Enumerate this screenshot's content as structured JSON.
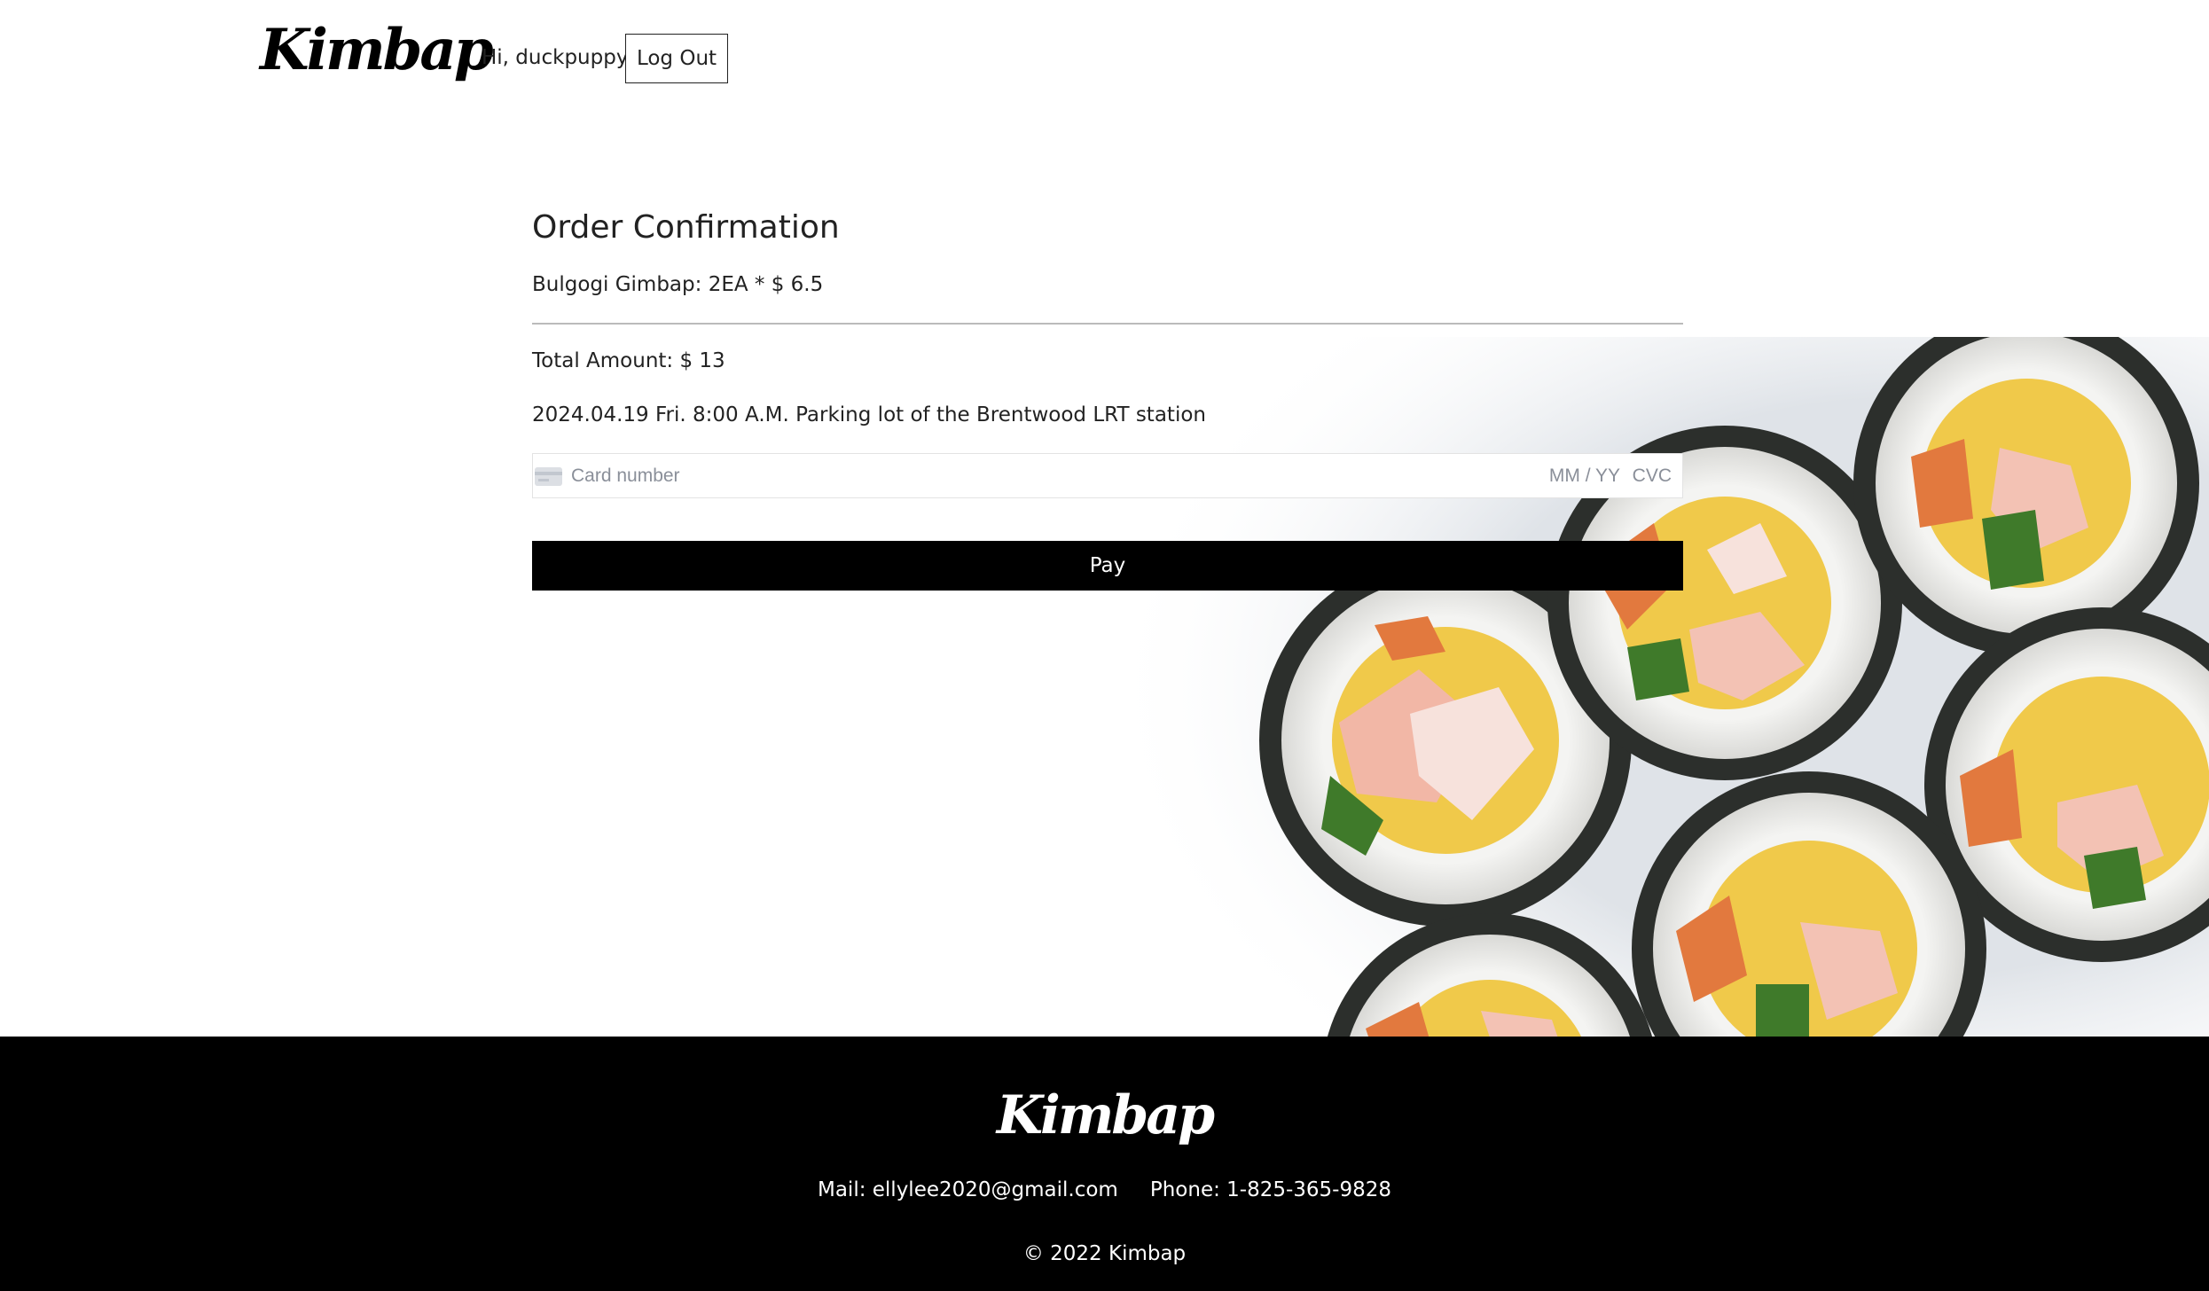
{
  "header": {
    "logo": "Kimbap",
    "greeting": "Hi, duckpuppy",
    "logout_label": "Log Out"
  },
  "order": {
    "title": "Order Confirmation",
    "item_line": "Bulgogi Gimbap: 2EA * $ 6.5",
    "total_line": "Total Amount: $ 13",
    "pickup_line": "2024.04.19 Fri. 8:00 A.M. Parking lot of the Brentwood LRT station"
  },
  "payment": {
    "card_placeholder": "Card number",
    "expiry_placeholder": "MM / YY",
    "cvc_placeholder": "CVC",
    "card_icon": "credit-card-icon",
    "pay_label": "Pay"
  },
  "footer": {
    "logo": "Kimbap",
    "mail": "Mail: ellylee2020@gmail.com",
    "phone": "Phone: 1-825-365-9828",
    "copyright": "© 2022 Kimbap"
  },
  "colors": {
    "button_bg": "#000000",
    "footer_bg": "#000000",
    "text": "#222222"
  }
}
